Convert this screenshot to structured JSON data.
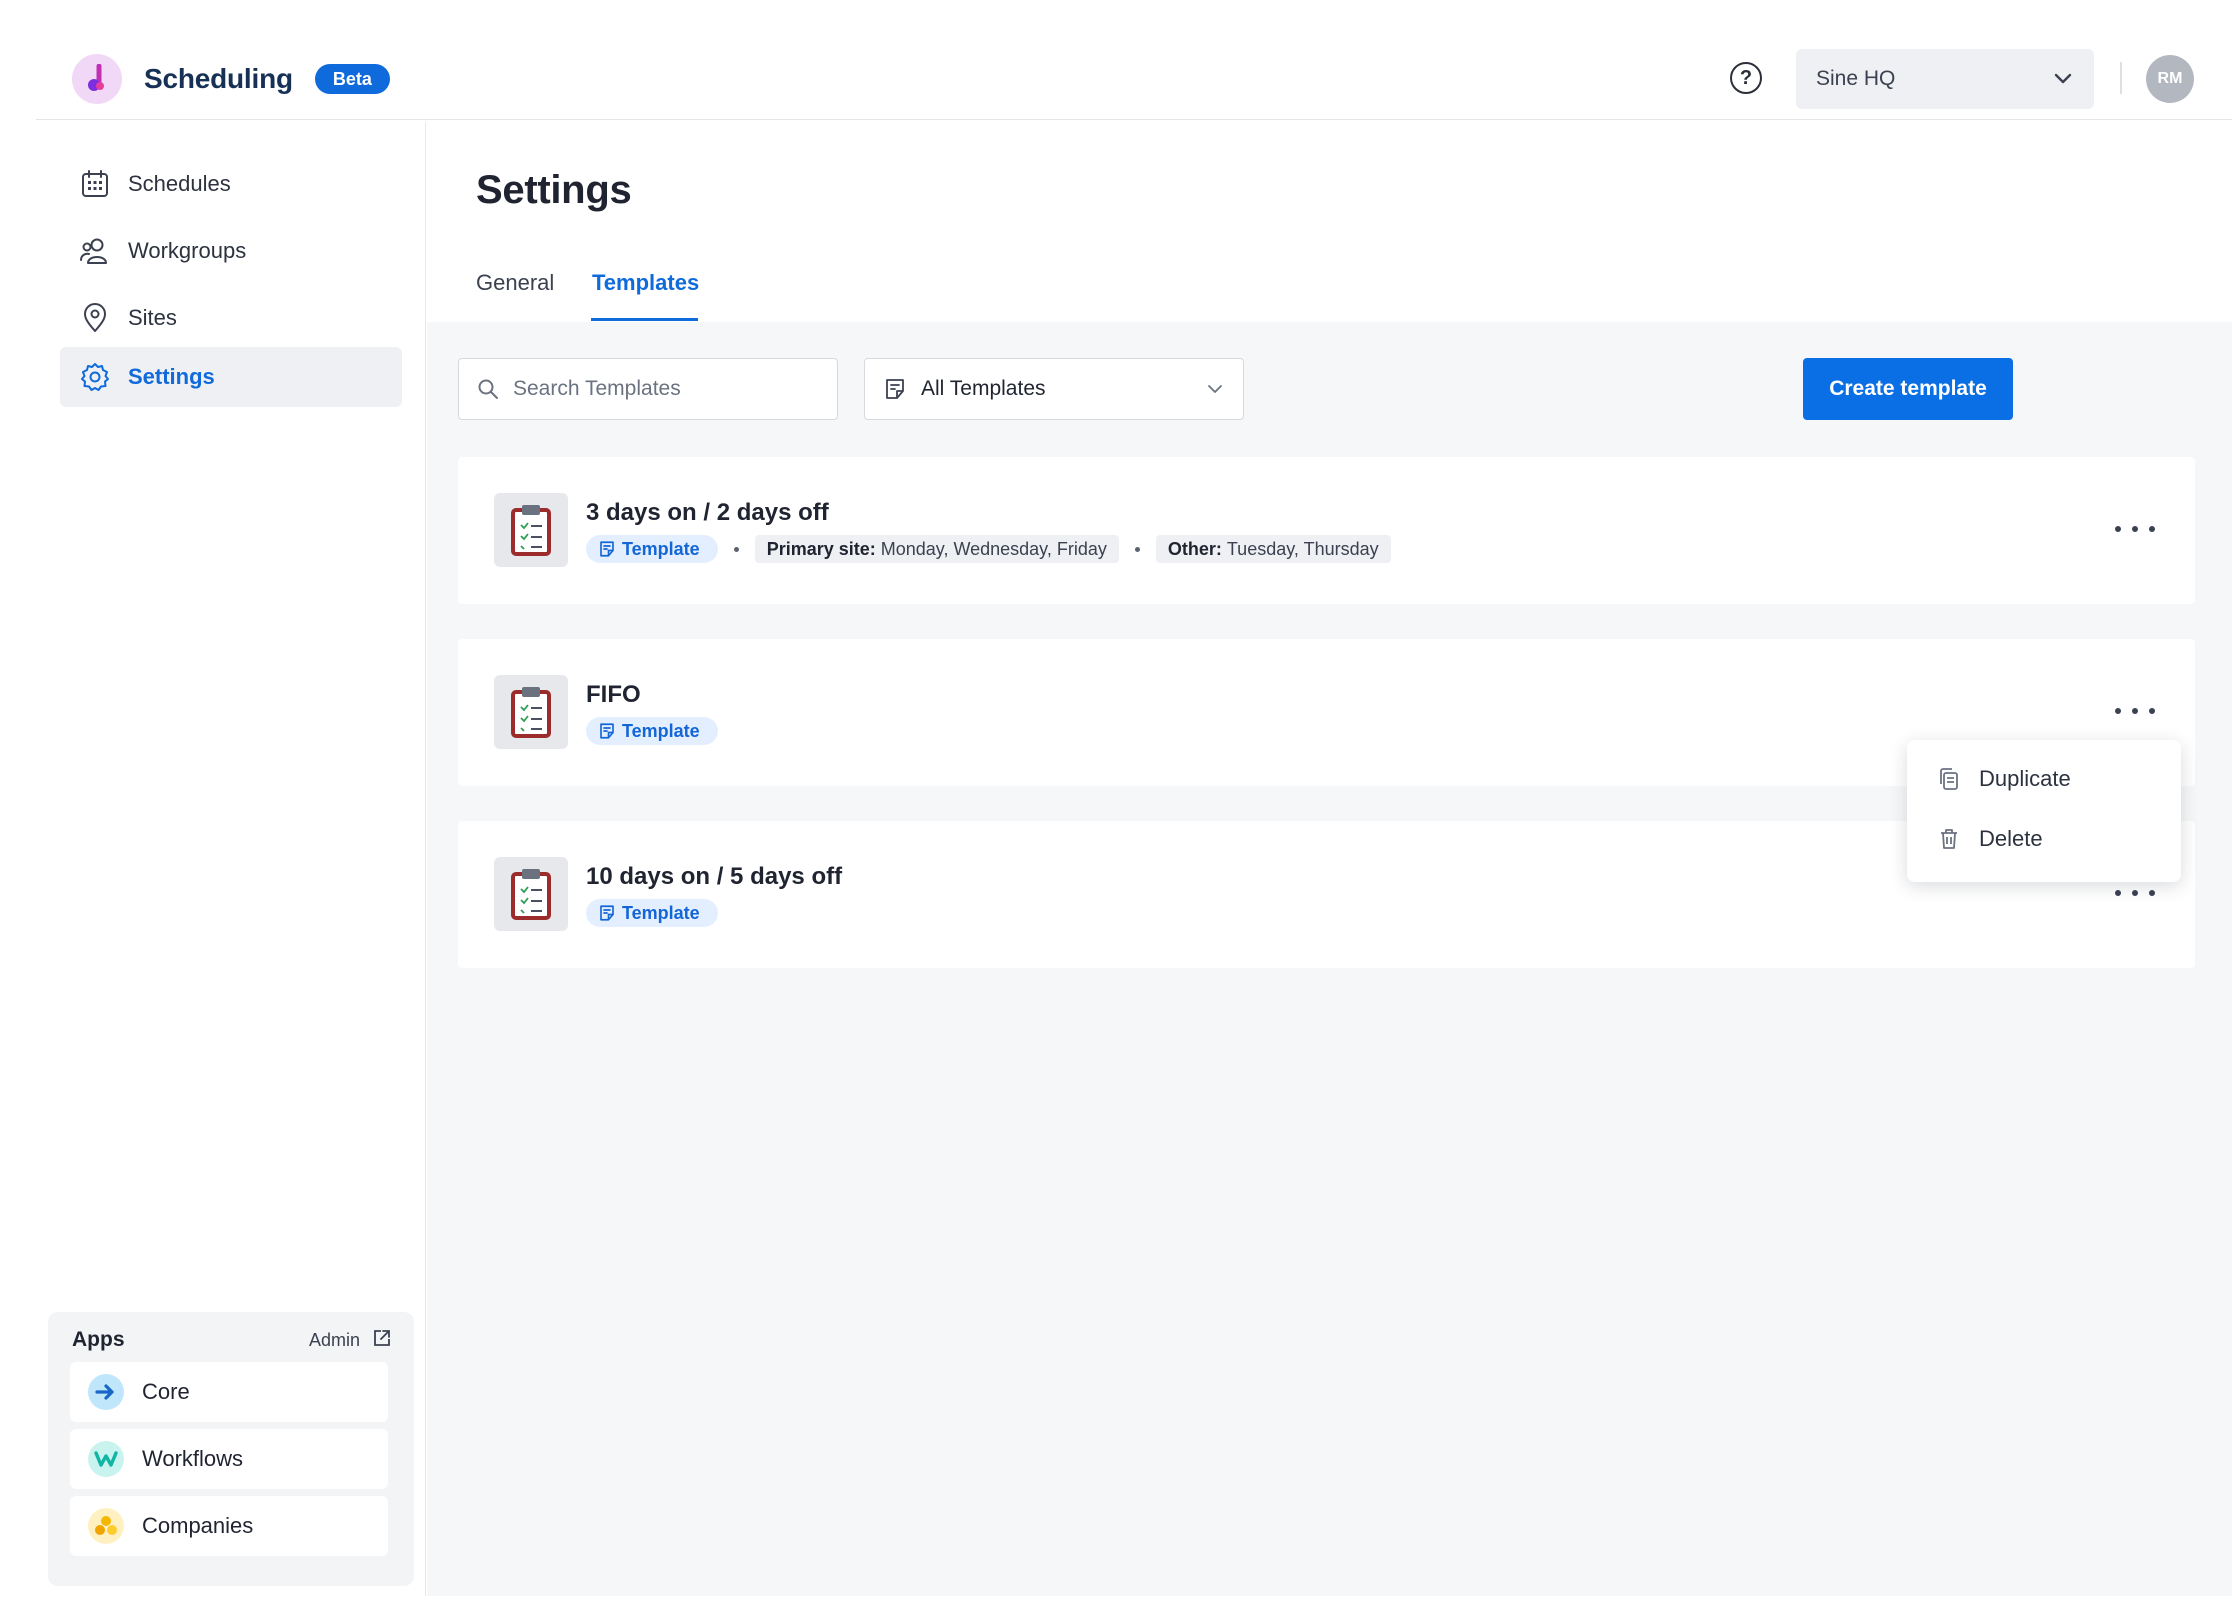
{
  "header": {
    "app_name": "Scheduling",
    "badge": "Beta",
    "org_selector": "Sine HQ",
    "avatar_initials": "RM",
    "help_symbol": "?"
  },
  "sidebar": {
    "items": [
      {
        "label": "Schedules",
        "icon": "calendar-icon"
      },
      {
        "label": "Workgroups",
        "icon": "people-icon"
      },
      {
        "label": "Sites",
        "icon": "location-pin-icon"
      },
      {
        "label": "Settings",
        "icon": "gear-icon",
        "active": true
      }
    ],
    "apps": {
      "title": "Apps",
      "admin_label": "Admin",
      "items": [
        {
          "label": "Core",
          "icon": "core-arrow-icon",
          "color": "#1aa3e8"
        },
        {
          "label": "Workflows",
          "icon": "workflows-w-icon",
          "color": "#14c8b8"
        },
        {
          "label": "Companies",
          "icon": "companies-icon",
          "color": "#f5b800"
        }
      ]
    }
  },
  "main": {
    "title": "Settings",
    "tabs": [
      {
        "label": "General",
        "active": false
      },
      {
        "label": "Templates",
        "active": true
      }
    ],
    "toolbar": {
      "search_placeholder": "Search Templates",
      "filter_value": "All Templates",
      "create_label": "Create template"
    },
    "templates": [
      {
        "title": "3 days on / 2 days off",
        "tag": "Template",
        "primary_label": "Primary site:",
        "primary_days": "Monday, Wednesday, Friday",
        "other_label": "Other:",
        "other_days": "Tuesday, Thursday"
      },
      {
        "title": "FIFO",
        "tag": "Template"
      },
      {
        "title": "10 days on / 5 days off",
        "tag": "Template"
      }
    ],
    "context_menu": {
      "duplicate": "Duplicate",
      "delete": "Delete"
    }
  },
  "colors": {
    "accent": "#0f6bdc",
    "primary_button": "#0a6fe4",
    "template_chip_bg": "#e3efff"
  }
}
